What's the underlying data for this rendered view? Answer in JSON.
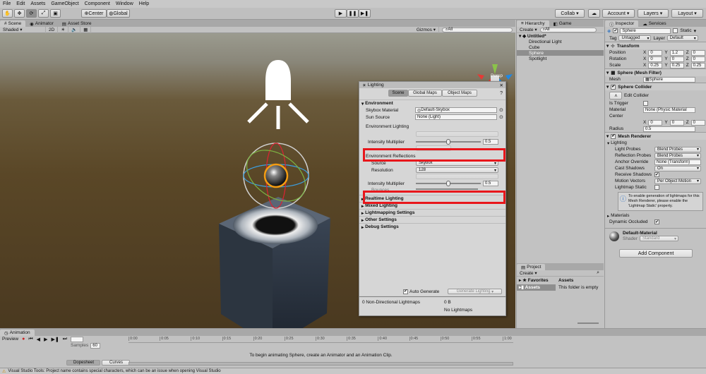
{
  "menu": [
    "File",
    "Edit",
    "Assets",
    "GameObject",
    "Component",
    "Window",
    "Help"
  ],
  "toolbar": {
    "center": "Center",
    "global": "Global",
    "collab": "Collab",
    "account": "Account",
    "layers": "Layers",
    "layout": "Layout"
  },
  "scene_tabs": [
    "Scene",
    "Animator",
    "Asset Store"
  ],
  "scene_bar": {
    "shaded": "Shaded",
    "mode2d": "2D",
    "gizmos": "Gizmos",
    "search": "All"
  },
  "gizmo_label": "Persp",
  "lighting": {
    "title": "Lighting",
    "tabs": [
      "Scene",
      "Global Maps",
      "Object Maps"
    ],
    "environment": "Environment",
    "skybox_label": "Skybox Material",
    "skybox_value": "Default-Skybox",
    "sun_label": "Sun Source",
    "sun_value": "None (Light)",
    "env_lighting": "Environment Lighting",
    "intensity_label": "Intensity Multiplier",
    "intensity_value": "0.5",
    "intensity_fraction": 0.5,
    "env_reflections": "Environment Reflections",
    "source_label": "Source",
    "source_value": "Skybox",
    "resolution_label": "Resolution",
    "resolution_value": "128",
    "refl_intensity_label": "Intensity Multiplier",
    "refl_intensity_value": "0.5",
    "refl_intensity_fraction": 0.5,
    "bounces_label": "Bounces",
    "sections": [
      "Realtime Lighting",
      "Mixed Lighting",
      "Lightmapping Settings",
      "Other Settings",
      "Debug Settings"
    ],
    "auto_generate": "Auto Generate",
    "generate_button": "Generate Lighting",
    "stats_left": "0 Non-Directional Lightmaps",
    "stats_size": "0 B",
    "stats_right": "No Lightmaps"
  },
  "hierarchy": {
    "tabs": [
      "Hierarchy",
      "Game"
    ],
    "create": "Create",
    "search": "All",
    "scene": "Untitled*",
    "items": [
      "Directional Light",
      "Cube",
      "Sphere",
      "Spotlight"
    ]
  },
  "project": {
    "tab": "Project",
    "create": "Create",
    "favorites": "Favorites",
    "assets": "Assets",
    "assets_header": "Assets",
    "empty": "This folder is empty"
  },
  "inspector": {
    "tabs": [
      "Inspector",
      "Services"
    ],
    "name": "Sphere",
    "static": "Static",
    "tag_label": "Tag",
    "tag": "Untagged",
    "layer_label": "Layer",
    "layer": "Default",
    "transform": "Transform",
    "position": {
      "label": "Position",
      "x": "0",
      "y": "1.2",
      "z": "0"
    },
    "rotation": {
      "label": "Rotation",
      "x": "0",
      "y": "0",
      "z": "0"
    },
    "scale": {
      "label": "Scale",
      "x": "0.25",
      "y": "0.25",
      "z": "0.25"
    },
    "mesh_filter": "Sphere (Mesh Filter)",
    "mesh_label": "Mesh",
    "mesh_value": "Sphere",
    "collider": "Sphere Collider",
    "edit_collider": "Edit Collider",
    "is_trigger": "Is Trigger",
    "material_label": "Material",
    "material_value": "None (Physic Material",
    "center": "Center",
    "cx": "0",
    "cy": "0",
    "cz": "0",
    "radius_label": "Radius",
    "radius": "0.5",
    "renderer": "Mesh Renderer",
    "lighting": "Lighting",
    "light_probes": "Light Probes",
    "light_probes_v": "Blend Probes",
    "refl_probes": "Reflection Probes",
    "refl_probes_v": "Blend Probes",
    "anchor": "Anchor Override",
    "anchor_v": "None (Transform)",
    "cast": "Cast Shadows",
    "cast_v": "On",
    "receive": "Receive Shadows",
    "motion": "Motion Vectors",
    "motion_v": "Per Object Motion",
    "lm_static": "Lightmap Static",
    "info": "To enable generation of lightmaps for this Mesh Renderer, please enable the 'Lightmap Static' property.",
    "materials": "Materials",
    "dyn_occ": "Dynamic Occluded",
    "mat_name": "Default-Material",
    "shader_label": "Shader",
    "shader": "Standard",
    "add_component": "Add Component"
  },
  "animation": {
    "tab": "Animation",
    "preview": "Preview",
    "samples_label": "Samples",
    "samples": "60",
    "ticks": [
      "0:00",
      "0:05",
      "0:10",
      "0:15",
      "0:20",
      "0:25",
      "0:30",
      "0:35",
      "0:40",
      "0:45",
      "0:50",
      "0:55",
      "1:00"
    ],
    "message": "To begin animating Sphere, create an Animator and an Animation Clip.",
    "dopesheet": "Dopesheet",
    "curves": "Curves"
  },
  "status": "Visual Studio Tools: Project name contains special characters, which can be an issue when opening Visual Studio"
}
